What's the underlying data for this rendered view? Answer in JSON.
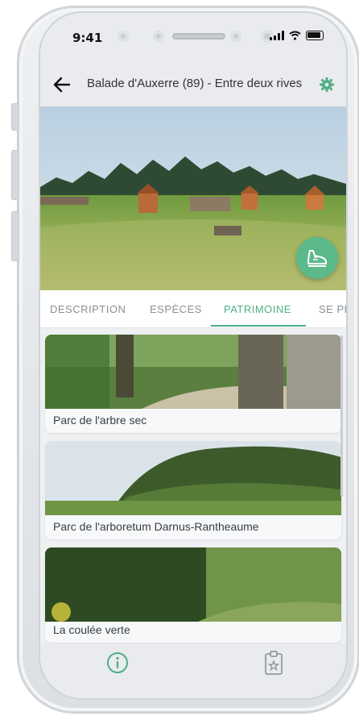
{
  "status_bar": {
    "time": "9:41"
  },
  "header": {
    "title": "Balade d'Auxerre (89) - Entre deux rives"
  },
  "tabs": [
    {
      "label": "DESCRIPTION"
    },
    {
      "label": "ESPÈCES"
    },
    {
      "label": "PATRIMOINE"
    },
    {
      "label": "SE PR"
    }
  ],
  "active_tab": "PATRIMOINE",
  "cards": [
    {
      "label": "Parc de l'arbre sec"
    },
    {
      "label": "Parc de l'arboretum Darnus-Rantheaume"
    },
    {
      "label": "La coulée verte"
    }
  ],
  "colors": {
    "accent": "#4fae86",
    "fab": "#5bb98a",
    "bar_bg": "#e9ebee"
  },
  "icons": [
    "back-arrow-icon",
    "gear-icon",
    "walking-shoe-icon",
    "info-icon",
    "clipboard-icon"
  ]
}
